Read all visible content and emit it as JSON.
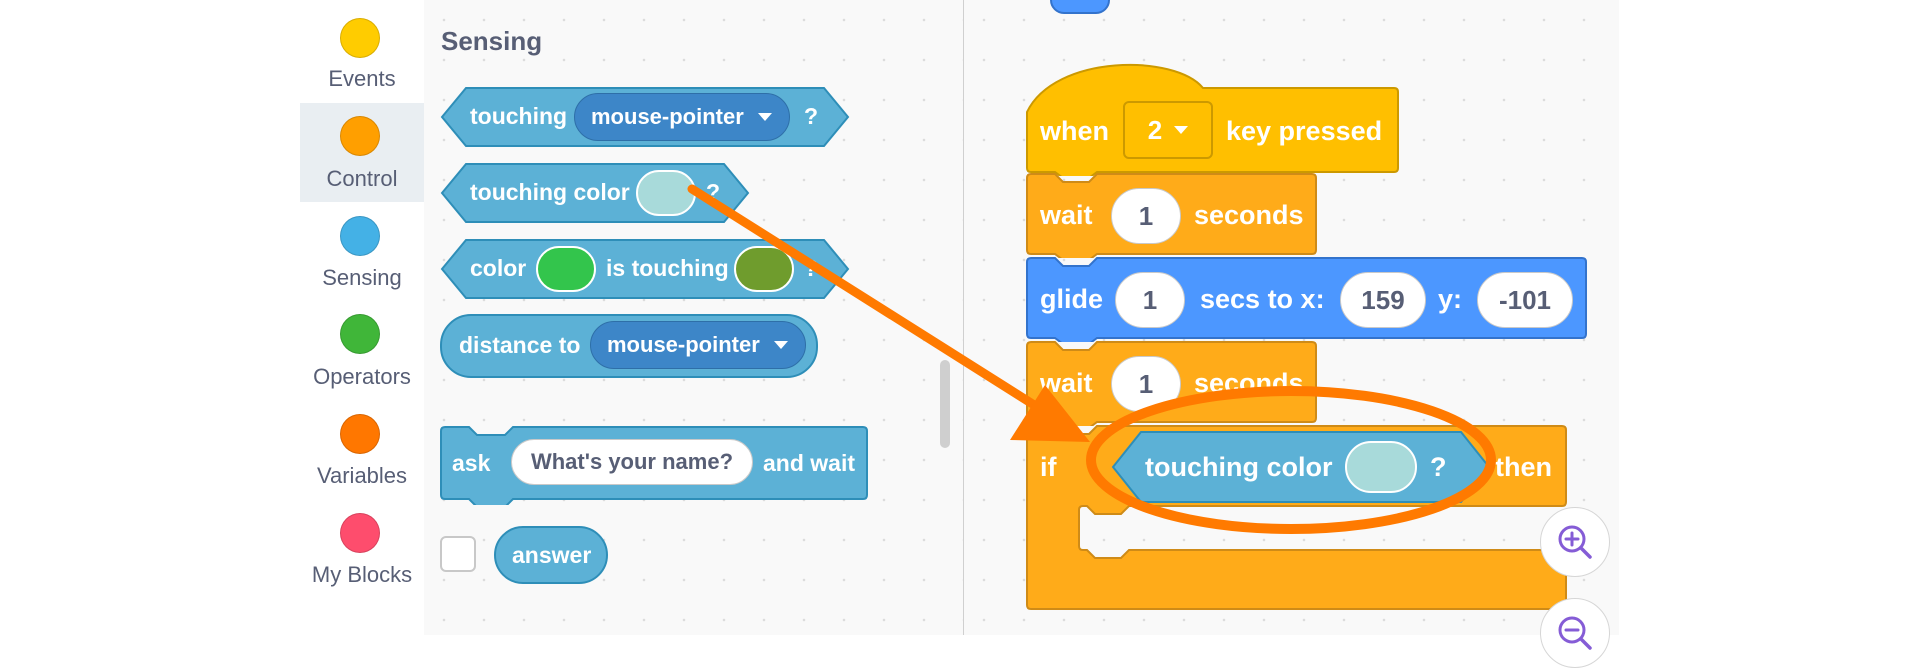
{
  "categories": [
    {
      "label": "Events",
      "color": "#ffcc00"
    },
    {
      "label": "Control",
      "color": "#ff9f00"
    },
    {
      "label": "Sensing",
      "color": "#44b1e6"
    },
    {
      "label": "Operators",
      "color": "#40b639"
    },
    {
      "label": "Variables",
      "color": "#ff7700"
    },
    {
      "label": "My Blocks",
      "color": "#fe4d6d"
    }
  ],
  "active_category": "Control",
  "palette": {
    "title": "Sensing",
    "blocks": {
      "touching": {
        "label": "touching",
        "dropdown": "mouse-pointer",
        "suffix": "?"
      },
      "touching_color": {
        "label": "touching color",
        "swatch": "#a8dada",
        "suffix": "?"
      },
      "color_touching": {
        "label1": "color",
        "swatch1": "#33c54c",
        "label2": "is touching",
        "swatch2": "#6f9c2d",
        "suffix": "?"
      },
      "distance_to": {
        "label": "distance to",
        "dropdown": "mouse-pointer"
      },
      "ask": {
        "label": "ask",
        "input": "What's your name?",
        "suffix": "and wait"
      },
      "answer": {
        "label": "answer"
      }
    }
  },
  "script": {
    "hat": {
      "label1": "when",
      "key": "2",
      "label2": "key pressed"
    },
    "wait1": {
      "label1": "wait",
      "value": "1",
      "label2": "seconds"
    },
    "glide": {
      "label1": "glide",
      "value": "1",
      "label2": "secs to x:",
      "x": "159",
      "label3": "y:",
      "y": "-101"
    },
    "wait2": {
      "label1": "wait",
      "value": "1",
      "label2": "seconds"
    },
    "if": {
      "label1": "if",
      "condition": "touching color",
      "swatch": "#a8dada",
      "suffix": "?",
      "label2": "then"
    }
  },
  "colors": {
    "sensing": "#5cb1d6",
    "sensing_dark": "#2e8eb8",
    "control": "#ffab19",
    "control_dark": "#cf8b17",
    "events": "#ffbf00",
    "motion": "#4c97ff",
    "annotation": "#ff7a00"
  },
  "icons": [
    "zoom-in-icon",
    "zoom-out-icon",
    "caret-down-icon",
    "arrow-annotation",
    "ellipse-annotation"
  ]
}
